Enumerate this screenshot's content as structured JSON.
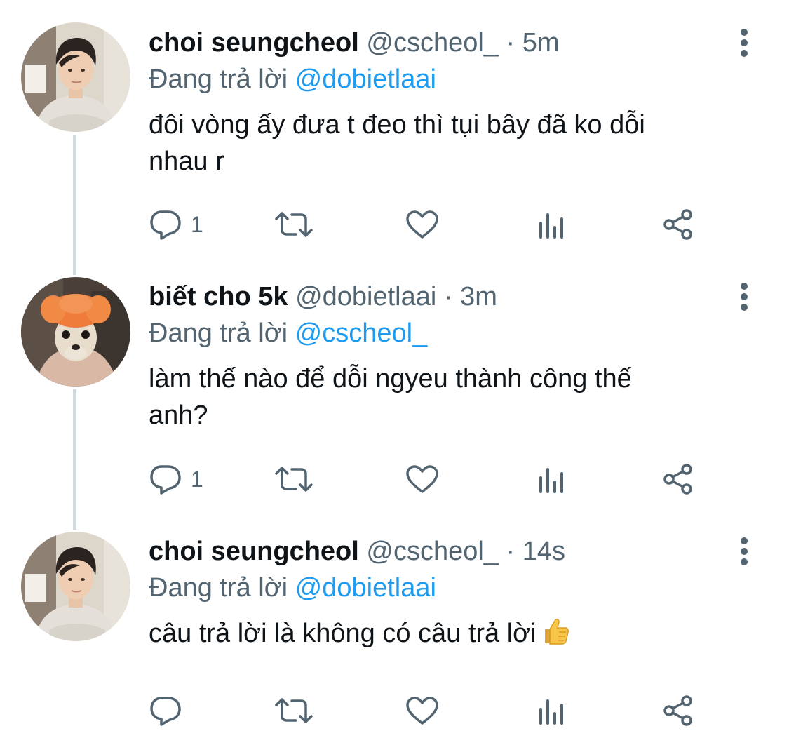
{
  "tweets": [
    {
      "display_name": "choi seungcheol",
      "handle": "@cscheol_",
      "separator": "·",
      "time": "5m",
      "reply_prefix": "Đang trả lời",
      "reply_to": "@dobietlaai",
      "text": "đôi vòng ấy đưa t đeo thì tụi bây đã ko dỗi\nnhau r",
      "reply_count": "1",
      "avatar": "person-avatar"
    },
    {
      "display_name": "biết cho 5k",
      "handle": "@dobietlaai",
      "separator": "·",
      "time": "3m",
      "reply_prefix": "Đang trả lời",
      "reply_to": "@cscheol_",
      "text": "làm thế nào để dỗi ngyeu thành công thế\nanh?",
      "reply_count": "1",
      "avatar": "dog-avatar"
    },
    {
      "display_name": "choi seungcheol",
      "handle": "@cscheol_",
      "separator": "·",
      "time": "14s",
      "reply_prefix": "Đang trả lời",
      "reply_to": "@dobietlaai",
      "text": "câu trả lời là không có câu trả lời",
      "reply_count": "",
      "avatar": "person-avatar",
      "trailing_emoji": "thumbs-up"
    }
  ],
  "icons": {
    "reply": "reply-icon",
    "retweet": "retweet-icon",
    "like": "heart-icon",
    "views": "views-icon",
    "share": "share-icon",
    "more": "more-vertical-icon"
  },
  "colors": {
    "text_primary": "#0f1419",
    "text_secondary": "#536471",
    "link": "#1d9bf0",
    "thread_line": "#cfd9de"
  }
}
